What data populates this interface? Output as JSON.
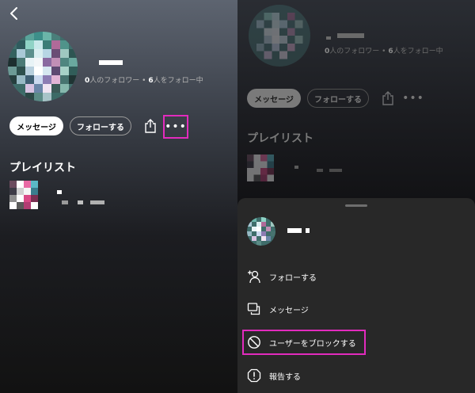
{
  "left": {
    "stats": {
      "followers_count": "0",
      "followers_label": "人のフォロワー",
      "separator": " • ",
      "following_count": "6",
      "following_label": "人をフォロー中"
    },
    "buttons": {
      "message": "メッセージ",
      "follow": "フォローする"
    },
    "section_title": "プレイリスト"
  },
  "right": {
    "stats": {
      "followers_count": "0",
      "followers_label": "人のフォロワー",
      "separator": " • ",
      "following_count": "6",
      "following_label": "人をフォロー中"
    },
    "buttons": {
      "message": "メッセージ",
      "follow": "フォローする"
    },
    "section_title": "プレイリスト",
    "sheet": {
      "items": [
        {
          "label": "フォローする",
          "icon": "add-user-icon"
        },
        {
          "label": "メッセージ",
          "icon": "message-icon"
        },
        {
          "label": "ユーザーをブロックする",
          "icon": "block-icon"
        },
        {
          "label": "報告する",
          "icon": "report-icon"
        }
      ]
    }
  },
  "colors": {
    "highlight": "#e22bbd",
    "sheet_bg": "#282828"
  }
}
